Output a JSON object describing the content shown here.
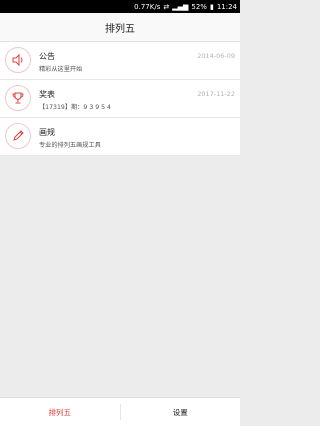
{
  "status_bar": {
    "speed": "0.77K/s",
    "battery": "52%",
    "time": "11:24"
  },
  "header": {
    "title": "排列五"
  },
  "list": [
    {
      "icon": "speaker-icon",
      "title": "公告",
      "subtitle": "精彩从这里开始",
      "date": "2014-06-09"
    },
    {
      "icon": "trophy-icon",
      "title": "奖表",
      "subtitle": "【17319】期：9 3 9 5 4",
      "date": "2017-11-22"
    },
    {
      "icon": "pencil-icon",
      "title": "画规",
      "subtitle": "专业的排列五画规工具",
      "date": ""
    }
  ],
  "tabs": [
    {
      "label": "排列五",
      "active": true
    },
    {
      "label": "设置",
      "active": false
    }
  ],
  "colors": {
    "accent": "#e33d3d",
    "icon_border": "#f1c7c7",
    "background": "#ececec"
  }
}
